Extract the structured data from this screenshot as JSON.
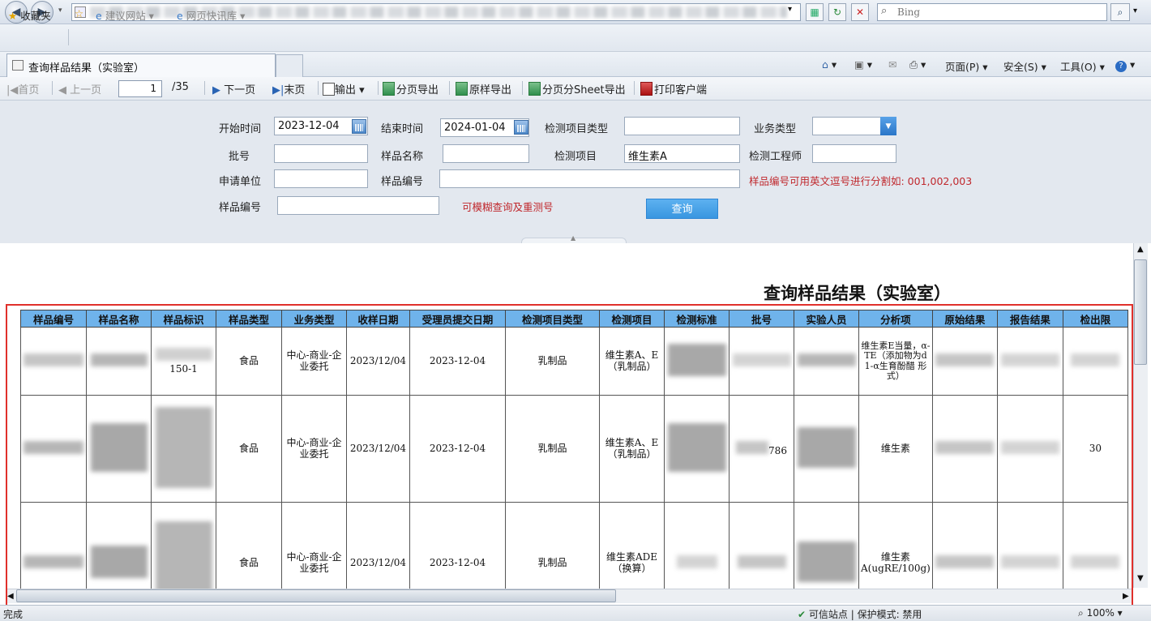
{
  "browser": {
    "search_placeholder": "Bing",
    "favorites_label": "收藏夹",
    "fav_links": [
      "建议网站 ▾",
      "网页快讯库 ▾"
    ],
    "tab_title": "查询样品结果（实验室）",
    "cmd": {
      "page": "页面(P) ▾",
      "safety": "安全(S) ▾",
      "tools": "工具(O) ▾"
    }
  },
  "toolbar": {
    "first": "首页",
    "prev": "上一页",
    "page_value": "1",
    "page_total": "/35",
    "next": "下一页",
    "last": "末页",
    "export": "输出 ▾",
    "paged_export": "分页导出",
    "raw_export": "原样导出",
    "sheet_export": "分页分Sheet导出",
    "print_client": "打印客户端"
  },
  "form": {
    "start_time_label": "开始时间",
    "start_time_value": "2023-12-04",
    "end_time_label": "结束时间",
    "end_time_value": "2024-01-04",
    "item_type_label": "检测项目类型",
    "business_type_label": "业务类型",
    "batch_label": "批号",
    "sample_name_label": "样品名称",
    "test_item_label": "检测项目",
    "test_item_value": "维生素A",
    "engineer_label": "检测工程师",
    "applicant_label": "申请单位",
    "sample_no_label": "样品编号",
    "sample_no_hint": "样品编号可用英文逗号进行分割如: 001,002,003",
    "sample_no2_label": "样品编号",
    "fuzzy_hint": "可模糊查询及重测号",
    "query_button": "查询"
  },
  "report": {
    "title": "查询样品结果（实验室）",
    "columns": [
      "样品编号",
      "样品名称",
      "样品标识",
      "样品类型",
      "业务类型",
      "收样日期",
      "受理员提交日期",
      "检测项目类型",
      "检测项目",
      "检测标准",
      "批号",
      "实验人员",
      "分析项",
      "原始结果",
      "报告结果",
      "检出限"
    ],
    "rows": [
      {
        "sample_type": "食品",
        "business_type": "中心-商业-企业委托",
        "receive_date": "2023/12/04",
        "submit_date": "2023-12-04",
        "item_type": "乳制品",
        "test_item": "维生素A、E（乳制品）",
        "analysis": "维生素E当量，α-TE（添加物为d 1-α生育酚醋 形式）",
        "mark_partial": "150-1"
      },
      {
        "sample_type": "食品",
        "business_type": "中心-商业-企业委托",
        "receive_date": "2023/12/04",
        "submit_date": "2023-12-04",
        "item_type": "乳制品",
        "test_item": "维生素A、E（乳制品）",
        "analysis": "维生素",
        "batch_partial": "786",
        "limit_partial": "30"
      },
      {
        "sample_type": "食品",
        "business_type": "中心-商业-企业委托",
        "receive_date": "2023/12/04",
        "submit_date": "2023-12-04",
        "item_type": "乳制品",
        "test_item": "维生素ADE（换算）",
        "analysis": "维生素A(ugRE/100g)"
      }
    ]
  },
  "status": {
    "left": "完成",
    "zone": "可信站点 | 保护模式: 禁用",
    "zoom": "100% ▾"
  }
}
